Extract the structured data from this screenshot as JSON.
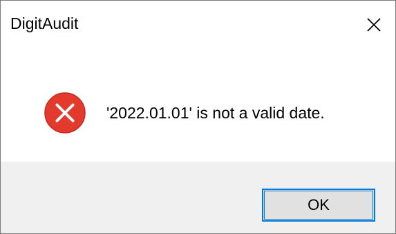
{
  "window": {
    "title": "DigitAudit",
    "close_icon": "close-icon"
  },
  "message": {
    "icon": "error-icon",
    "text": "'2022.01.01' is not a valid date."
  },
  "buttons": {
    "ok_label": "OK"
  },
  "colors": {
    "error_red": "#e81123",
    "focus_border": "#0078d7",
    "footer_bg": "#f0f0f0",
    "button_bg": "#e1e1e1"
  }
}
